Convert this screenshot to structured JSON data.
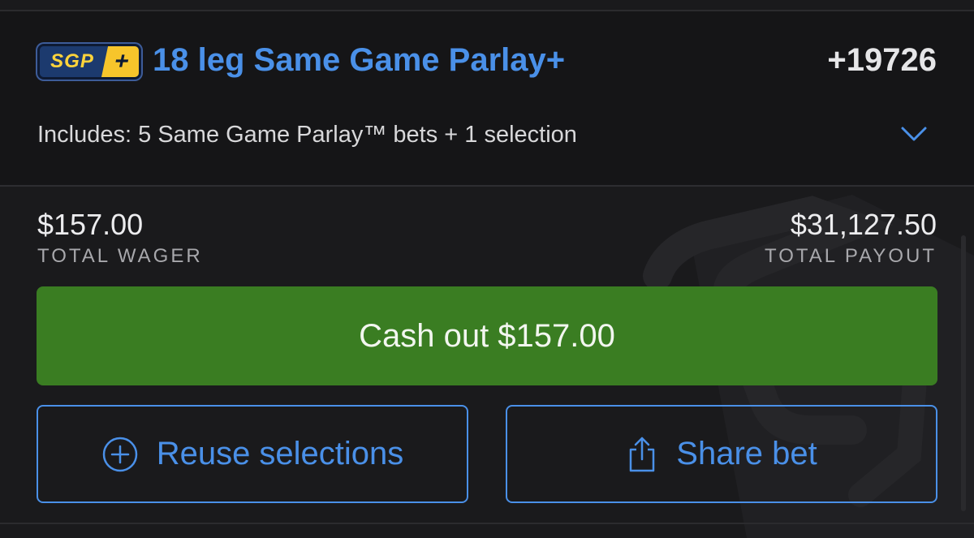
{
  "bet": {
    "badge_text": "SGP",
    "badge_plus": "+",
    "title": "18 leg Same Game Parlay+",
    "odds": "+19726",
    "includes": "Includes: 5 Same Game Parlay™ bets + 1 selection"
  },
  "summary": {
    "wager_amount": "$157.00",
    "wager_label": "TOTAL WAGER",
    "payout_amount": "$31,127.50",
    "payout_label": "TOTAL PAYOUT"
  },
  "actions": {
    "cashout_label": "Cash out $157.00",
    "reuse_label": "Reuse selections",
    "share_label": "Share bet"
  },
  "icons": {
    "expand": "chevron-down-icon",
    "reuse": "plus-circle-icon",
    "share": "share-icon",
    "watermark": "shield-logo-watermark"
  },
  "colors": {
    "accent_blue": "#4a90e8",
    "cashout_green": "#3a7d22",
    "badge_yellow": "#f7c52b",
    "badge_navy": "#1c3a6e"
  }
}
